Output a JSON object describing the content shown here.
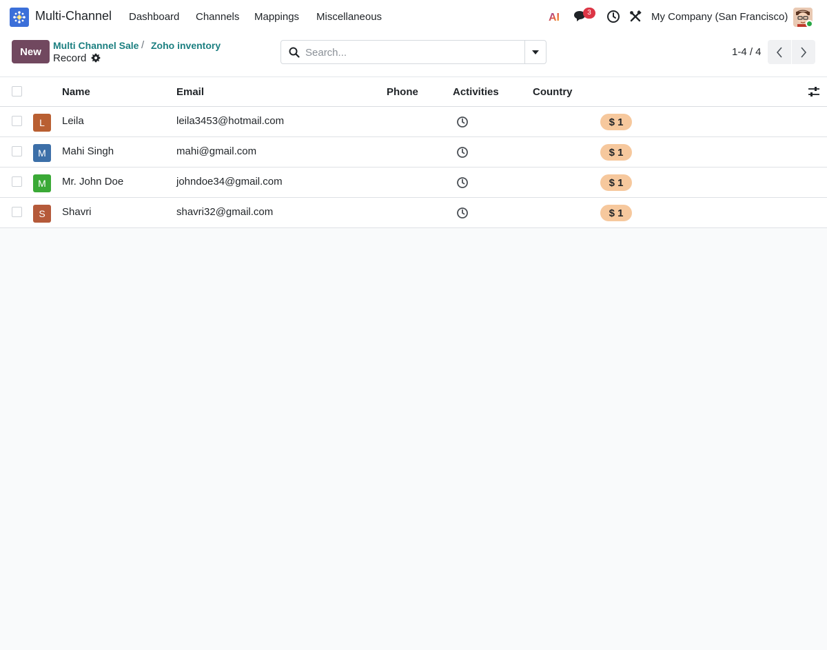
{
  "navbar": {
    "app_name": "Multi-Channel",
    "menu": [
      "Dashboard",
      "Channels",
      "Mappings",
      "Miscellaneous"
    ],
    "ai_label": "AI",
    "messages_badge": "3",
    "company": "My Company (San Francisco)"
  },
  "control": {
    "new_label": "New",
    "breadcrumbs": [
      "Multi Channel Sale",
      "Zoho inventory"
    ],
    "separator": "/",
    "current": "Record",
    "search_placeholder": "Search...",
    "pager": "1-4 / 4"
  },
  "table": {
    "columns": [
      "Name",
      "Email",
      "Phone",
      "Activities",
      "Country"
    ],
    "rows": [
      {
        "initial": "L",
        "avatar_color": "#b95f32",
        "name": "Leila",
        "email": "leila3453@hotmail.com",
        "phone": "",
        "tag": "$ 1"
      },
      {
        "initial": "M",
        "avatar_color": "#3c6fa8",
        "name": "Mahi Singh",
        "email": "mahi@gmail.com",
        "phone": "",
        "tag": "$ 1"
      },
      {
        "initial": "M",
        "avatar_color": "#3aa936",
        "name": "Mr. John Doe",
        "email": "johndoe34@gmail.com",
        "phone": "",
        "tag": "$ 1"
      },
      {
        "initial": "S",
        "avatar_color": "#b55a3a",
        "name": "Shavri",
        "email": "shavri32@gmail.com",
        "phone": "",
        "tag": "$ 1"
      }
    ]
  },
  "colors": {
    "primary": "#71485f",
    "link": "#1b7f80",
    "tag_bg": "#f6c89d",
    "badge": "#dc3545"
  }
}
